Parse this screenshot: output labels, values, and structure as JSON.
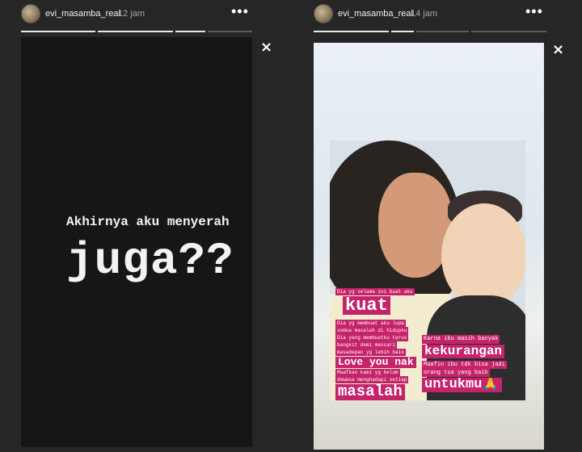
{
  "left_story": {
    "username": "evi_masamba_real",
    "time": "12 jam",
    "more_icon": "more-horizontal-icon",
    "line1": "Akhirnya aku menyerah",
    "line2": "juga??",
    "close_icon": "close-icon",
    "close_label": "×"
  },
  "right_story": {
    "username": "evi_masamba_real",
    "time": "14 jam",
    "more_icon": "more-horizontal-icon",
    "close_icon": "close-icon",
    "close_label": "×",
    "sticker": {
      "l1": "Dia yg selama ini buat aku",
      "l2": "kuat",
      "l3a": "Dia yg membuat aku lupa",
      "l3b": "semua masalah di hidupku",
      "l3c": "Dia yang membuatku terus",
      "l3d": "bangkit demi mencari",
      "l3e": "masadepan yg lebih baik",
      "l4": "Love you nak",
      "l5a": "Maafkan kami yg belum",
      "l5b": "dewasa menghadapi setiap",
      "l6": "masalah",
      "r1": "Karna ibu masih banyak",
      "r2": "kekurangan",
      "r3a": "Maafin ibu tdk bisa jadi",
      "r3b": "orang tua yang baik",
      "r4": "untukmu🙏"
    }
  },
  "icons": {
    "more": "•••",
    "close": "×"
  }
}
